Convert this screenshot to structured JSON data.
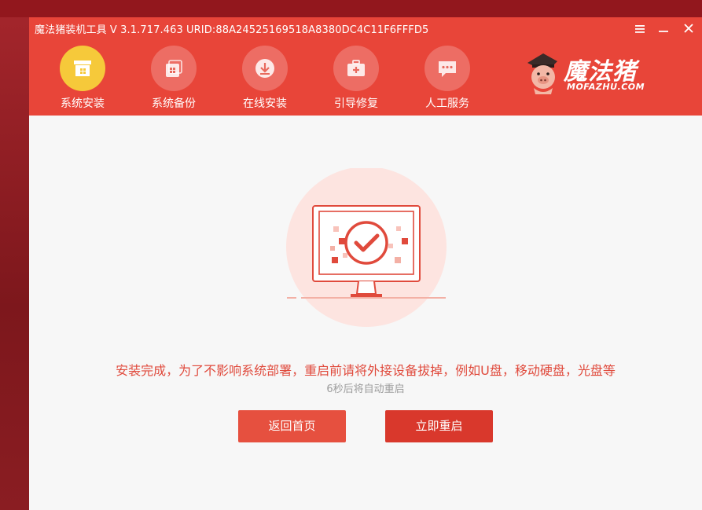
{
  "window": {
    "title": "魔法猪装机工具 V 3.1.717.463 URID:88A24525169518A8380DC4C11F6FFFD5"
  },
  "nav": {
    "items": [
      {
        "label": "系统安装",
        "icon": "install-box-icon",
        "active": true
      },
      {
        "label": "系统备份",
        "icon": "backup-icon",
        "active": false
      },
      {
        "label": "在线安装",
        "icon": "download-icon",
        "active": false
      },
      {
        "label": "引导修复",
        "icon": "toolbox-icon",
        "active": false
      },
      {
        "label": "人工服务",
        "icon": "chat-icon",
        "active": false
      }
    ]
  },
  "brand": {
    "name": "魔法猪",
    "domain": "MOFAZHU.COM"
  },
  "main": {
    "message": "安装完成，为了不影响系统部署，重启前请将外接设备拔掉，例如U盘，移动硬盘，光盘等",
    "countdown": "6秒后将自动重启",
    "buttons": {
      "home": "返回首页",
      "restart": "立即重启"
    }
  },
  "colors": {
    "header": "#e84539",
    "accent": "#e04a3c",
    "active_tab": "#f6c93a",
    "background": "#f7f7f7"
  }
}
